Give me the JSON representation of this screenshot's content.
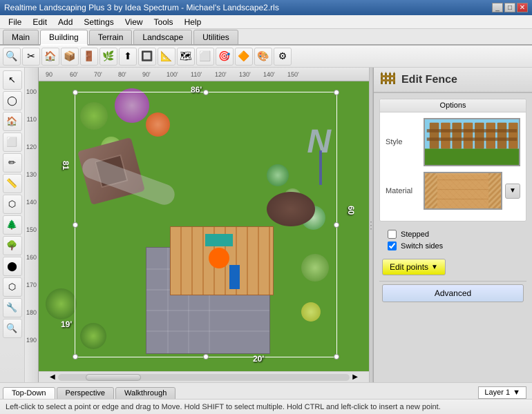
{
  "window": {
    "title": "Realtime Landscaping Plus 3 by Idea Spectrum - Michael's Landscape2.rls",
    "controls": [
      "_",
      "□",
      "✕"
    ]
  },
  "menu": {
    "items": [
      "File",
      "Edit",
      "Add",
      "Settings",
      "View",
      "Tools",
      "Help"
    ]
  },
  "tabs": {
    "main": "Main",
    "building": "Building",
    "terrain": "Terrain",
    "landscape": "Landscape",
    "utilities": "Utilities"
  },
  "active_tab": "Building",
  "toolbar": {
    "tools": [
      "🔍",
      "✏️",
      "🏠",
      "📦",
      "🚪",
      "🌿",
      "⬆",
      "🔲",
      "📐",
      "🗺",
      "⬜",
      "🎯",
      "🔶",
      "🎨",
      "⚙"
    ]
  },
  "left_tools": [
    "↖",
    "◯",
    "🏠",
    "🔲",
    "✏",
    "📏",
    "⬡",
    "🌲",
    "🌳",
    "⬤",
    "⬡",
    "🔧",
    "🔍"
  ],
  "panel": {
    "title": "Edit Fence",
    "icon": "fence",
    "sections": {
      "options": {
        "label": "Options",
        "style_label": "Style",
        "material_label": "Material"
      }
    },
    "checkboxes": {
      "stepped": {
        "label": "Stepped",
        "checked": false
      },
      "switch_sides": {
        "label": "Switch sides",
        "checked": true
      }
    },
    "buttons": {
      "edit_points": "Edit points",
      "advanced": "Advanced"
    }
  },
  "canvas": {
    "measurements": {
      "top": "86'",
      "right": "60",
      "bottom": "20'",
      "left_v1": "81",
      "left_v2": "19'"
    },
    "north_label": "N"
  },
  "bottom_tabs": {
    "top_down": "Top-Down",
    "perspective": "Perspective",
    "walkthrough": "Walkthrough"
  },
  "active_view": "Top-Down",
  "layer": "Layer 1",
  "status": "Left-click to select a point or edge and drag to Move. Hold SHIFT to select multiple. Hold CTRL and left-click to insert a new point.",
  "ruler": {
    "h_marks": [
      "90",
      "60'",
      "70'",
      "80'",
      "90'",
      "100'",
      "110'",
      "120'",
      "130'",
      "140'",
      "150'"
    ],
    "v_marks": [
      "100",
      "110",
      "120",
      "130",
      "140",
      "150",
      "160",
      "170",
      "180",
      "190"
    ]
  }
}
